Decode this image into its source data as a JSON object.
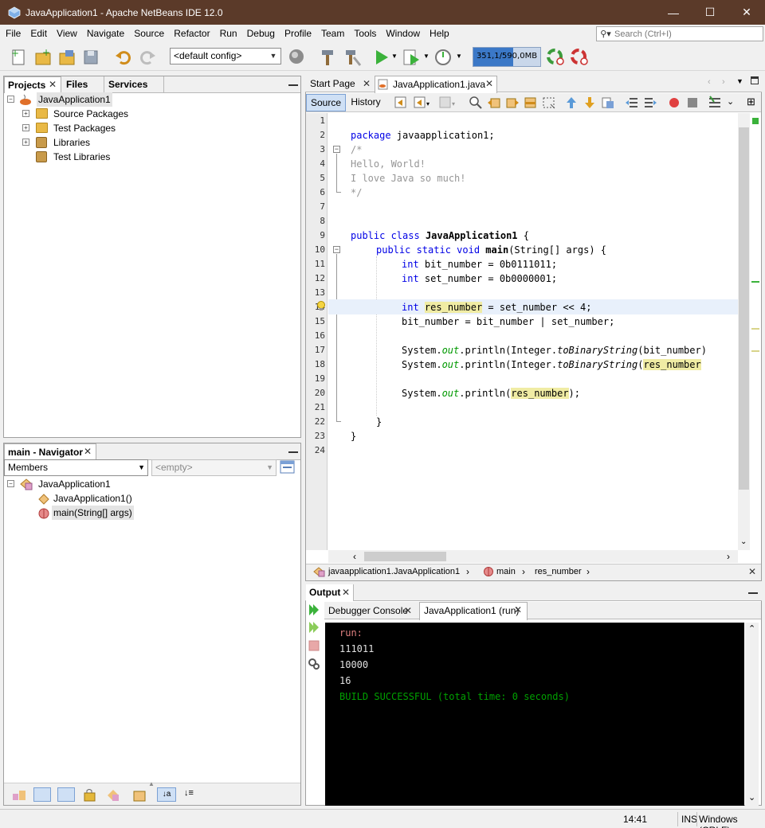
{
  "window": {
    "title": "JavaApplication1 - Apache NetBeans IDE 12.0",
    "minimize": "—",
    "maximize": "☐",
    "close": "✕"
  },
  "menu": [
    "File",
    "Edit",
    "View",
    "Navigate",
    "Source",
    "Refactor",
    "Run",
    "Debug",
    "Profile",
    "Team",
    "Tools",
    "Window",
    "Help"
  ],
  "search": {
    "placeholder": "Search (Ctrl+I)"
  },
  "toolbar": {
    "config": "<default config>",
    "memory": "351,1/590,0MB",
    "memory_fraction": 0.6
  },
  "projects_panel": {
    "tabs": [
      "Projects",
      "Files",
      "Services"
    ],
    "tree": {
      "root": "JavaApplication1",
      "children": [
        "Source Packages",
        "Test Packages",
        "Libraries",
        "Test Libraries"
      ]
    }
  },
  "navigator": {
    "title": "main - Navigator",
    "filter": "Members",
    "empty": "<empty>",
    "class": "JavaApplication1",
    "members": [
      "JavaApplication1()",
      "main(String[] args)"
    ]
  },
  "editor": {
    "tabs": [
      "Start Page",
      "JavaApplication1.java"
    ],
    "modes": [
      "Source",
      "History"
    ],
    "line_numbers": [
      "1",
      "2",
      "3",
      "4",
      "5",
      "6",
      "7",
      "8",
      "9",
      "10",
      "11",
      "12",
      "13",
      "14",
      "15",
      "16",
      "17",
      "18",
      "19",
      "20",
      "21",
      "22",
      "23",
      "24"
    ],
    "code": {
      "l2_kw": "package",
      "l2_rest": " javaapplication1;",
      "l3": "/*",
      "l4": "Hello, World!",
      "l5": "I love Java so much!",
      "l6": "*/",
      "l9_kw": "public class",
      "l9_name": "JavaApplication1",
      "l9_rest": " {",
      "l10_kw": "public static void",
      "l10_name": "main",
      "l10_rest": "(String[] args) {",
      "l11_kw": "int",
      "l11_rest": " bit_number = 0b0111011;",
      "l12_kw": "int",
      "l12_rest": " set_number = 0b0000001;",
      "l14_kw": "int",
      "l14_var": "res_number",
      "l14_rest": " = set_number << 4;",
      "l15": "bit_number = bit_number | set_number;",
      "l17_a": "System.",
      "l17_out": "out",
      "l17_b": ".println(Integer.",
      "l17_m": "toBinaryString",
      "l17_c": "(bit_number)",
      "l18_a": "System.",
      "l18_out": "out",
      "l18_b": ".println(Integer.",
      "l18_m": "toBinaryString",
      "l18_c": "(",
      "l18_var": "res_number",
      "l20_a": "System.",
      "l20_out": "out",
      "l20_b": ".println(",
      "l20_var": "res_number",
      "l20_c": ");",
      "l22": "}",
      "l23": "}"
    },
    "breadcrumb": [
      "javaapplication1.JavaApplication1",
      "main",
      "res_number"
    ]
  },
  "output": {
    "title": "Output",
    "tabs": [
      "Debugger Console",
      "JavaApplication1 (run)"
    ],
    "lines": [
      "run:",
      "111011",
      "10000",
      "16"
    ],
    "success": "BUILD SUCCESSFUL (total time: 0 seconds)",
    "colors": {
      "run": "#e08080",
      "text": "#e0e0e0",
      "success": "#00a000"
    }
  },
  "status": {
    "position": "14:41",
    "mode": "INS",
    "line_ending": "Windows (CRLF)"
  }
}
